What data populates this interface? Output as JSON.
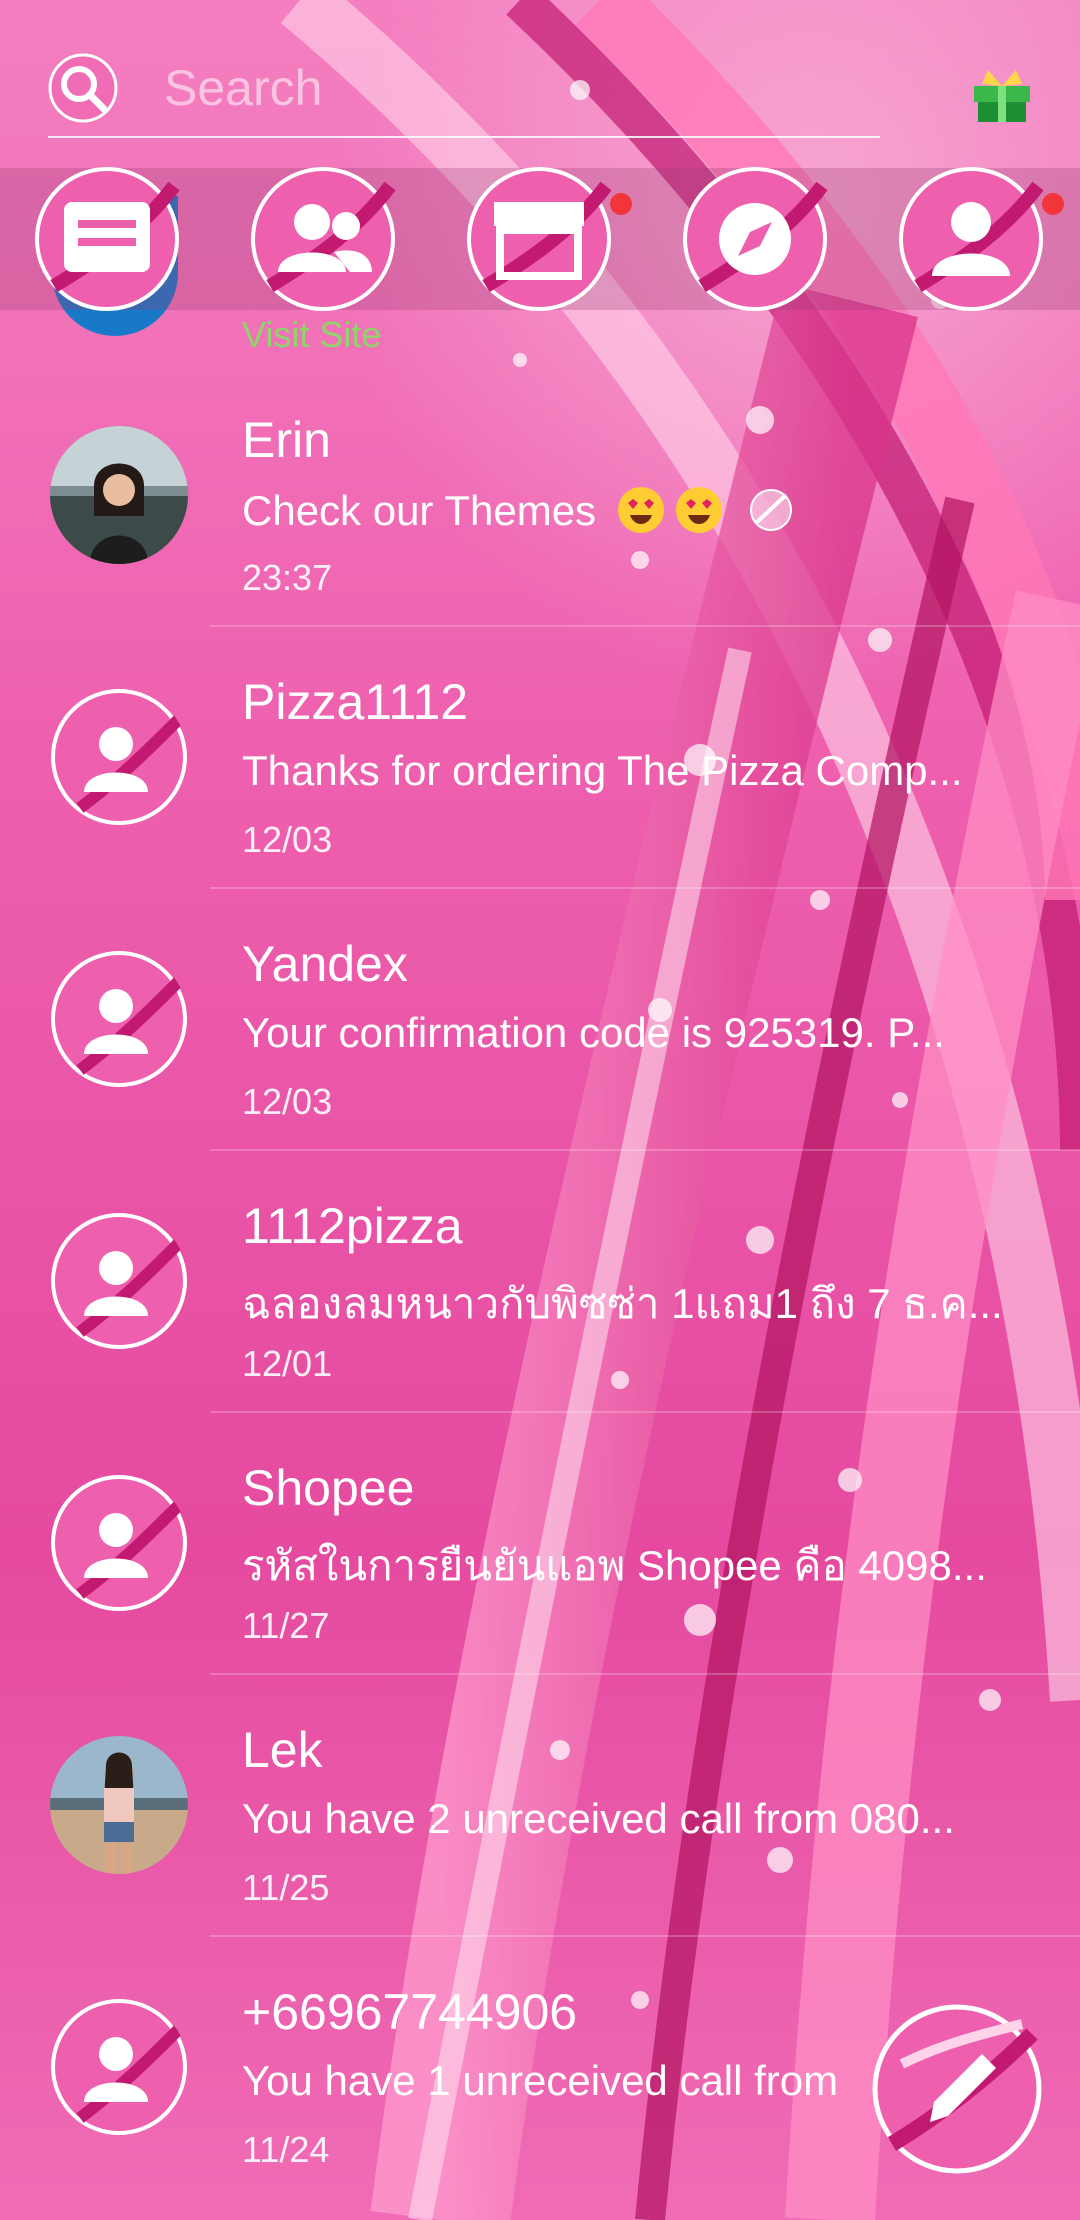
{
  "search": {
    "placeholder": "Search"
  },
  "top_actions": [
    {
      "name": "menu",
      "icon": "menu-icon",
      "badge": false
    },
    {
      "name": "contacts",
      "icon": "contacts-icon",
      "badge": false
    },
    {
      "name": "store",
      "icon": "store-icon",
      "badge": true
    },
    {
      "name": "discover",
      "icon": "compass-icon",
      "badge": false
    },
    {
      "name": "profile",
      "icon": "profile-icon",
      "badge": true
    }
  ],
  "visit_site": {
    "label": "Visit Site"
  },
  "conversations": [
    {
      "name": "Erin",
      "message": "Check our Themes",
      "time": "23:37",
      "avatar": "photo"
    },
    {
      "name": "Pizza1112",
      "message": "Thanks for ordering The Pizza Comp...",
      "time": "12/03",
      "avatar": "default"
    },
    {
      "name": "Yandex",
      "message": "Your confirmation code is 925319. P...",
      "time": "12/03",
      "avatar": "default"
    },
    {
      "name": "1112pizza",
      "message": "ฉลองลมหนาวกับพิซซ่า 1แถม1 ถึง 7 ธ.ค...",
      "time": "12/01",
      "avatar": "default"
    },
    {
      "name": "Shopee",
      "message": "รหัสในการยืนยันแอพ Shopee คือ 4098...",
      "time": "11/27",
      "avatar": "default"
    },
    {
      "name": "Lek",
      "message": "You have 2 unreceived call from 080...",
      "time": "11/25",
      "avatar": "photo"
    },
    {
      "name": "+66967744906",
      "message": "You have 1 unreceived call from",
      "time": "11/24",
      "avatar": "default"
    }
  ],
  "colors": {
    "accent_pink": "#e54a9f",
    "link_green": "#8fd46a",
    "badge_red": "#f2353b"
  }
}
